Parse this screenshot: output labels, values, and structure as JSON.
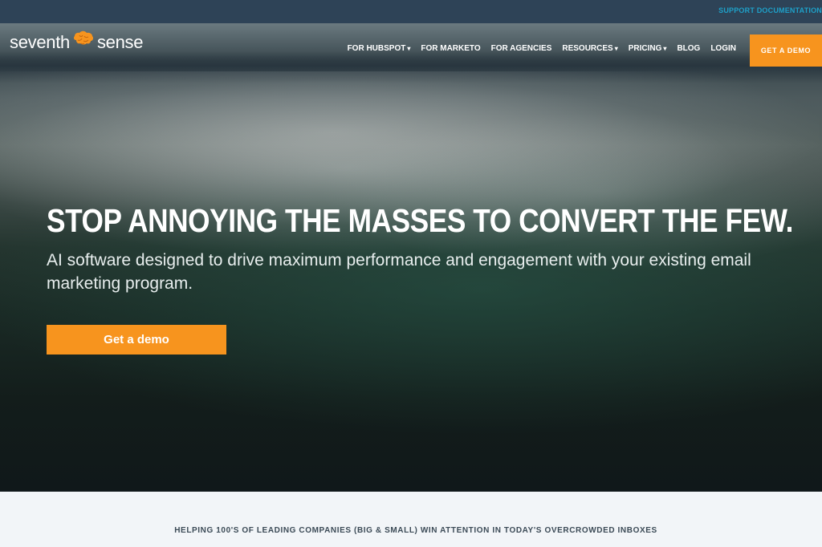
{
  "topbar": {
    "support_link": "SUPPORT DOCUMENTATION"
  },
  "logo": {
    "left_text": "seventh",
    "right_text": "sense",
    "icon": "brain-icon",
    "accent_color": "#f7941e"
  },
  "nav": {
    "items": [
      {
        "label": "FOR HUBSPOT",
        "dropdown": true
      },
      {
        "label": "FOR MARKETO",
        "dropdown": false
      },
      {
        "label": "FOR AGENCIES",
        "dropdown": false
      },
      {
        "label": "RESOURCES",
        "dropdown": true
      },
      {
        "label": "PRICING",
        "dropdown": true
      },
      {
        "label": "BLOG",
        "dropdown": false
      },
      {
        "label": "LOGIN",
        "dropdown": false
      }
    ],
    "cta_label": "GET A DEMO",
    "chevron": "chevron-down-icon"
  },
  "hero": {
    "headline": "STOP ANNOYING THE MASSES TO CONVERT THE FEW.",
    "subhead": "AI software designed to drive maximum performance and engagement with your existing email marketing program.",
    "cta_label": "Get a demo"
  },
  "trust": {
    "caption": "HELPING 100'S OF LEADING COMPANIES (BIG & SMALL) WIN ATTENTION IN TODAY'S OVERCROWDED INBOXES"
  },
  "colors": {
    "topbar": "#2e4357",
    "accent": "#f7941e",
    "link": "#1ea0c8"
  }
}
